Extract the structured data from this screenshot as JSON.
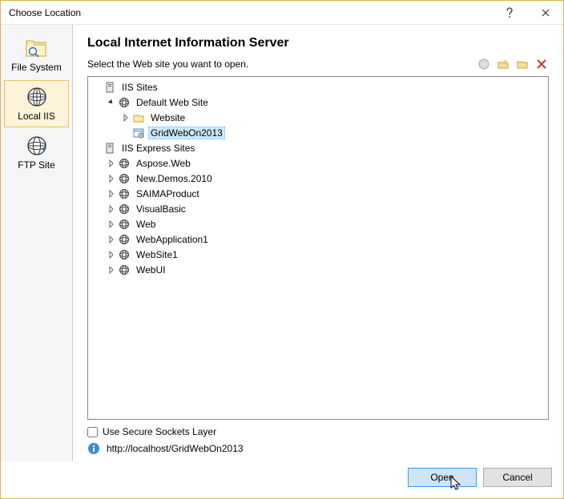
{
  "window": {
    "title": "Choose Location"
  },
  "sidebar": {
    "items": [
      {
        "label": "File System"
      },
      {
        "label": "Local IIS"
      },
      {
        "label": "FTP Site"
      }
    ],
    "selectedIndex": 1
  },
  "header": "Local Internet Information Server",
  "subheader": "Select the Web site you want to open.",
  "tree": {
    "nodes": [
      {
        "level": 0,
        "exp": "",
        "kind": "server",
        "label": "IIS Sites"
      },
      {
        "level": 1,
        "exp": "open",
        "kind": "globe",
        "label": "Default Web Site"
      },
      {
        "level": 2,
        "exp": "closed",
        "kind": "folder",
        "label": "Website"
      },
      {
        "level": 2,
        "exp": "",
        "kind": "app",
        "label": "GridWebOn2013",
        "selected": true
      },
      {
        "level": 0,
        "exp": "",
        "kind": "server",
        "label": "IIS Express Sites"
      },
      {
        "level": 1,
        "exp": "closed",
        "kind": "globe",
        "label": "Aspose.Web"
      },
      {
        "level": 1,
        "exp": "closed",
        "kind": "globe",
        "label": "New.Demos.2010"
      },
      {
        "level": 1,
        "exp": "closed",
        "kind": "globe",
        "label": "SAIMAProduct"
      },
      {
        "level": 1,
        "exp": "closed",
        "kind": "globe",
        "label": "VisualBasic"
      },
      {
        "level": 1,
        "exp": "closed",
        "kind": "globe",
        "label": "Web"
      },
      {
        "level": 1,
        "exp": "closed",
        "kind": "globe",
        "label": "WebApplication1"
      },
      {
        "level": 1,
        "exp": "closed",
        "kind": "globe",
        "label": "WebSite1"
      },
      {
        "level": 1,
        "exp": "closed",
        "kind": "globe",
        "label": "WebUI"
      }
    ]
  },
  "ssl": {
    "label": "Use Secure Sockets Layer",
    "checked": false
  },
  "url": "http://localhost/GridWebOn2013",
  "buttons": {
    "open": "Open",
    "cancel": "Cancel"
  }
}
